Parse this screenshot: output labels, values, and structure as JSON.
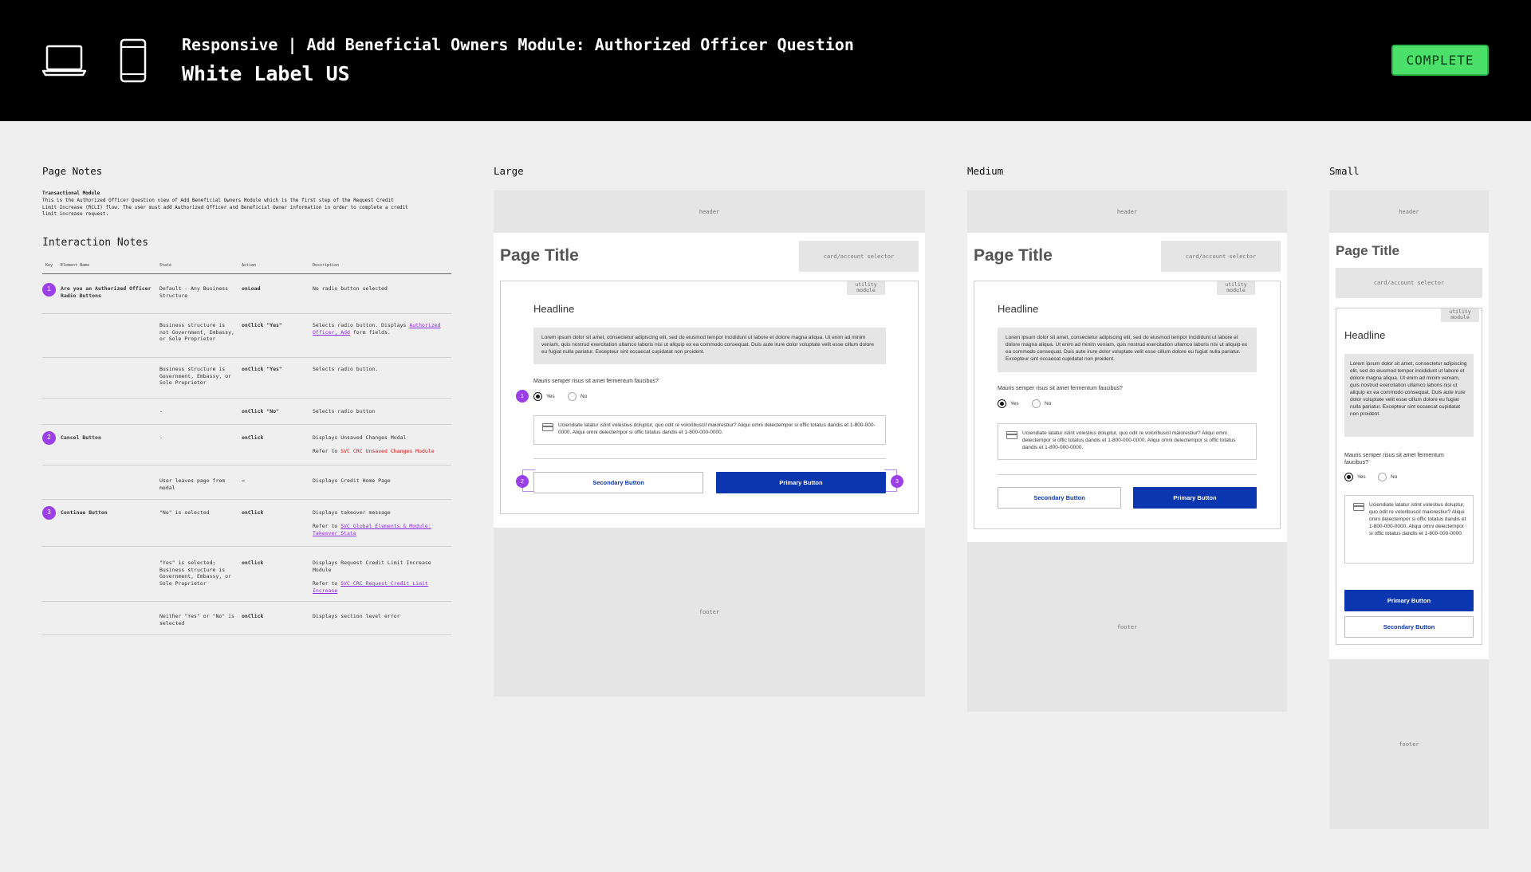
{
  "header": {
    "title": "Responsive | Add Beneficial Owners Module: Authorized Officer Question",
    "subtitle": "White Label US",
    "status": "COMPLETE",
    "icons": [
      "laptop-icon",
      "phone-icon"
    ]
  },
  "notes": {
    "page_notes_label": "Page Notes",
    "subtitle": "Transactional Module",
    "description": "This is the Authorized Officer Question view of Add Beneficial Owners Module which is the first step of the Request Credit Limit Increase (RCLI) flow. The user must add Authorized Officer and Beneficial Owner information in order to complete a credit limit increase request.",
    "interaction_label": "Interaction Notes",
    "columns": [
      "Key",
      "Element Name",
      "State",
      "Action",
      "Description"
    ],
    "rows": [
      {
        "key": "1",
        "element": "Are you an Authorized Officer Radio Buttons",
        "state": "Default - Any Business Structure",
        "action": "onLoad",
        "desc": "No radio button selected",
        "refer_pre": "",
        "refer_link": "",
        "refer_post": ""
      },
      {
        "key": "",
        "element": "",
        "state": "Business structure is not Government, Embassy, or Sole Proprietor",
        "action": "onClick \"Yes\"",
        "desc": "Selects radio button. Displays ",
        "desc_link": "Authorized Officer, Add",
        "desc_post": " form fields.",
        "refer_pre": "",
        "refer_link": "",
        "refer_post": ""
      },
      {
        "key": "",
        "element": "",
        "state": "Business structure is Government, Embassy, or Sole Proprietor",
        "action": "onClick \"Yes\"",
        "desc": "Selects radio button.",
        "refer_pre": "",
        "refer_link": "",
        "refer_post": ""
      },
      {
        "key": "",
        "element": "",
        "state": "-",
        "action": "onClick \"No\"",
        "desc": "Selects radio button",
        "refer_pre": "",
        "refer_link": "",
        "refer_post": ""
      },
      {
        "key": "2",
        "element": "Cancel Button",
        "state": "-",
        "action": "onClick",
        "desc": "Displays Unsaved Changes Modal",
        "refer_pre": "Refer to ",
        "refer_link": "SVC CRC Unsaved Changes Module",
        "refer_post": ""
      },
      {
        "key": "",
        "element": "",
        "state": "User leaves page from modal",
        "action": "–",
        "desc": "Displays Credit Home Page",
        "refer_pre": "",
        "refer_link": "",
        "refer_post": ""
      },
      {
        "key": "3",
        "element": "Continue Button",
        "state": "\"No\" is selected",
        "action": "onClick",
        "desc": "Displays takeover message",
        "refer_pre": "Refer to ",
        "refer_link": "SVC Global Elements & Module: Takeover State",
        "refer_post": ""
      },
      {
        "key": "",
        "element": "",
        "state": "\"Yes\" is selected; Business structure is Government, Embassy, or Sole Proprietor",
        "action": "onClick",
        "desc": "Displays Request Credit Limit Increase Module",
        "refer_pre": "Refer to ",
        "refer_link": "SVC CRC Request Credit Limit Increase",
        "refer_post": ""
      },
      {
        "key": "",
        "element": "",
        "state": "Neither \"Yes\" or \"No\" is selected",
        "action": "onClick",
        "desc": "Displays section level error",
        "refer_pre": "",
        "refer_link": "",
        "refer_post": ""
      }
    ]
  },
  "wire": {
    "large_label": "Large",
    "medium_label": "Medium",
    "small_label": "Small",
    "header": "header",
    "footer": "footer",
    "page_title": "Page Title",
    "selector": "card/account selector",
    "utility": "utility module",
    "headline": "Headline",
    "lorem": "Lorem ipsum dolor sit amet, consectetur adipiscing elit, sed do eiusmod tempor incididunt ut labore et dolore magna aliqua. Ut enim ad minim veniam, quis nostrud exercitation ullamco laboris nisi ut aliquip ex ea commodo consequat. Duis aute irure dolor voluptate velit esse cillum dolore eu fugiat nulla pariatur. Excepteur sint occaecat cupidatat non proident.",
    "question": "Mauris semper risus sit amet fermentum faucibus?",
    "yes": "Yes",
    "no": "No",
    "info": "Uciendiate latatur istint volestius doluptur, quo odit re voloribuscil maiorestiur? Aliqui omni delectempor si offic totatus dandis et 1-800-000-0000. Aliqui omni delectempor si offic totatus dandis et 1-800-000-0000.",
    "secondary": "Secondary Button",
    "primary": "Primary Button",
    "badges": [
      "1",
      "2",
      "3"
    ]
  }
}
